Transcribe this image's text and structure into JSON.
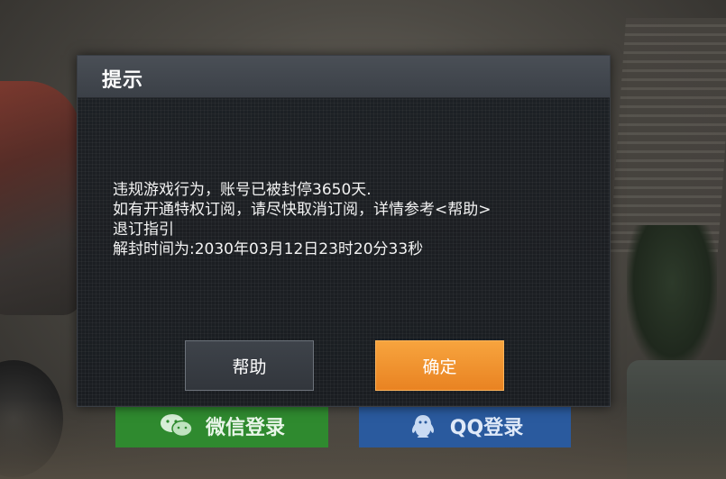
{
  "dialog": {
    "title": "提示",
    "message_lines": [
      "违规游戏行为，账号已被封停3650天.",
      "如有开通特权订阅，请尽快取消订阅，详情参考<帮助>",
      "退订指引",
      "解封时间为:2030年03月12日23时20分33秒"
    ],
    "help_label": "帮助",
    "confirm_label": "确定"
  },
  "login": {
    "wechat_label": "微信登录",
    "qq_label": "QQ登录"
  },
  "colors": {
    "confirm": "#f2952f",
    "wechat": "#2f8a2f",
    "qq": "#2a5a9e"
  },
  "icons": [
    "wechat-icon",
    "qq-icon"
  ]
}
